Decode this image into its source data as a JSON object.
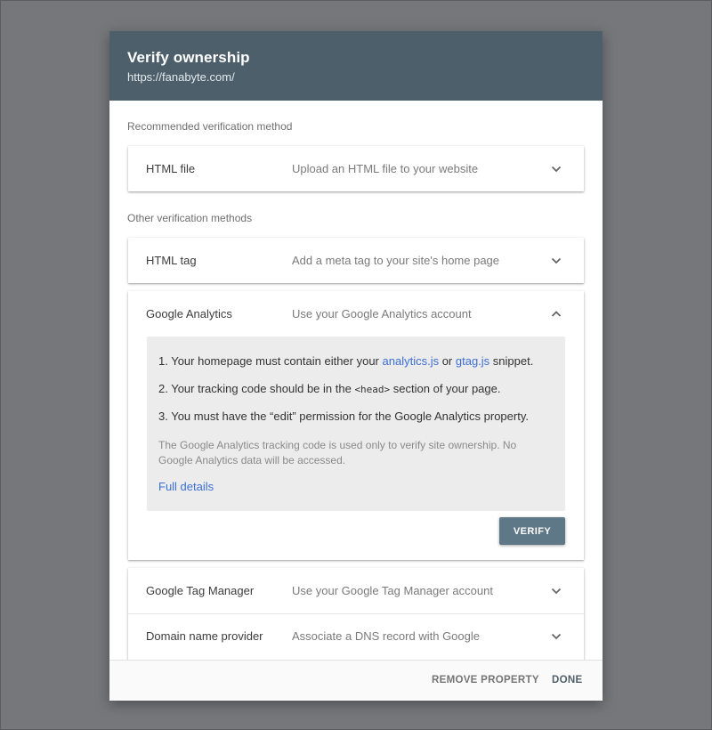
{
  "dialog": {
    "title": "Verify ownership",
    "subtitle": "https://fanabyte.com/"
  },
  "recommended_label": "Recommended verification method",
  "other_label": "Other verification methods",
  "methods": [
    {
      "name": "HTML file",
      "description": "Upload an HTML file to your website",
      "expanded": false
    },
    {
      "name": "HTML tag",
      "description": "Add a meta tag to your site's home page",
      "expanded": false
    },
    {
      "name": "Google Analytics",
      "description": "Use your Google Analytics account",
      "expanded": true
    },
    {
      "name": "Google Tag Manager",
      "description": "Use your Google Tag Manager account",
      "expanded": false
    },
    {
      "name": "Domain name provider",
      "description": "Associate a DNS record with Google",
      "expanded": false
    }
  ],
  "analytics_panel": {
    "step1_prefix": "1. Your homepage must contain either your ",
    "step1_link1": "analytics.js",
    "step1_mid": " or ",
    "step1_link2": "gtag.js",
    "step1_suffix": " snippet.",
    "step2_prefix": "2. Your tracking code should be in the ",
    "step2_code": "<head>",
    "step2_suffix": " section of your page.",
    "step3": "3. You must have the “edit” permission for the Google Analytics property.",
    "note": "The Google Analytics tracking code is used only to verify site ownership. No Google Analytics data will be accessed.",
    "full_details": "Full details",
    "verify_label": "VERIFY"
  },
  "footer": {
    "remove_label": "REMOVE PROPERTY",
    "done_label": "DONE"
  },
  "colors": {
    "header_bg": "#4c5f6b",
    "link": "#3d6fd6",
    "verify_button": "#5f7887",
    "backdrop": "#75777b"
  },
  "icons": {
    "collapsed": "chevron-down-icon",
    "expanded": "chevron-up-icon"
  }
}
